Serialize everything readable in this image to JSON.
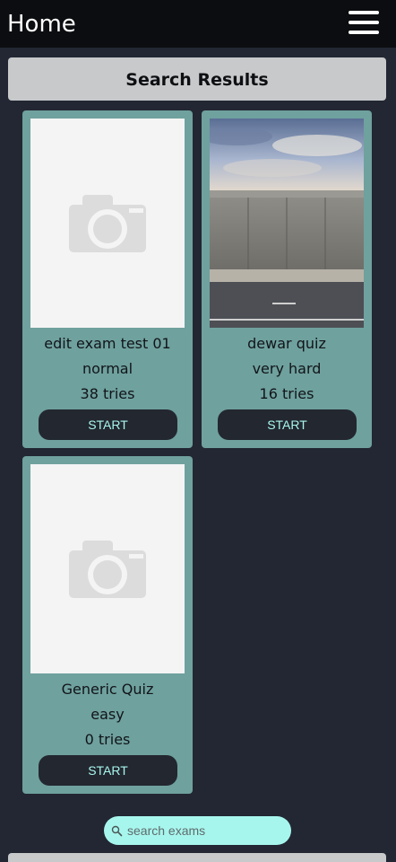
{
  "app": {
    "title": "Home",
    "menu_icon": "hamburger-menu-icon"
  },
  "results": {
    "header": "Search Results"
  },
  "exams": [
    {
      "title": "edit exam test 01",
      "difficulty": "normal",
      "tries": "38 tries",
      "start_label": "START",
      "image": "camera-placeholder-icon"
    },
    {
      "title": "dewar quiz",
      "difficulty": "very hard",
      "tries": "16 tries",
      "start_label": "START",
      "image": "concrete-wall-photo"
    },
    {
      "title": "Generic Quiz",
      "difficulty": "easy",
      "tries": "0 tries",
      "start_label": "START",
      "image": "camera-placeholder-icon"
    }
  ],
  "search": {
    "placeholder": "search exams",
    "value": "",
    "icon": "search-icon"
  },
  "colors": {
    "background": "#222733",
    "appbar": "#0c0d10",
    "card": "#6fa19e",
    "button": "#23272f",
    "button_text": "#a7f6ee",
    "search_pill": "#a7f6ee"
  }
}
